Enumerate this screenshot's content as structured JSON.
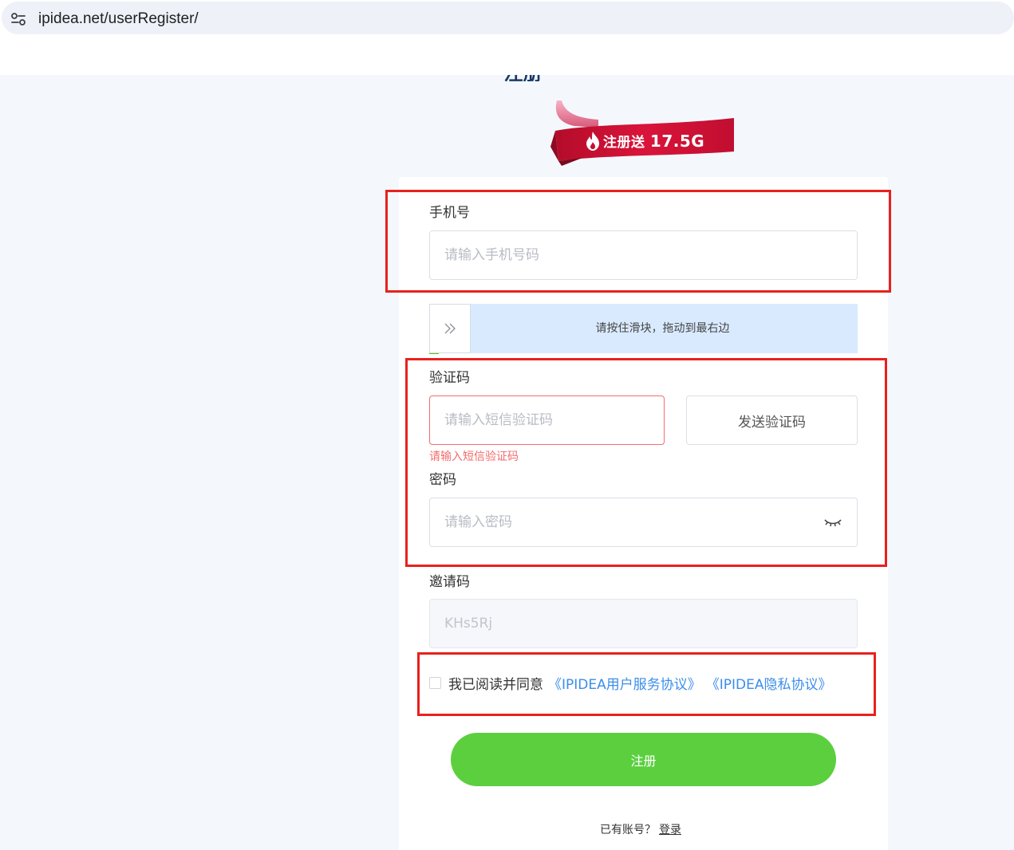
{
  "browser": {
    "url": "ipidea.net/userRegister/"
  },
  "page": {
    "title": "注册",
    "promo": {
      "text": "注册送",
      "amount": "17.5G"
    }
  },
  "form": {
    "phone": {
      "label": "手机号",
      "placeholder": "请输入手机号码",
      "value": ""
    },
    "slider": {
      "hint": "请按住滑块，拖动到最右边"
    },
    "code": {
      "label": "验证码",
      "placeholder": "请输入短信验证码",
      "value": "",
      "error": "请输入短信验证码",
      "send_button": "发送验证码"
    },
    "password": {
      "label": "密码",
      "placeholder": "请输入密码",
      "value": ""
    },
    "invite": {
      "label": "邀请码",
      "value": "KHs5Rj"
    },
    "agreement": {
      "text": "我已阅读并同意",
      "terms_link": "《IPIDEA用户服务协议》",
      "privacy_link": "《IPIDEA隐私协议》",
      "checked": false
    },
    "submit_label": "注册",
    "login_prompt": "已有账号？",
    "login_link": "登录"
  },
  "colors": {
    "accent_green": "#5ccf3f",
    "link_blue": "#3b8eea",
    "error_red": "#f56c6c",
    "annotation_red": "#e8211d",
    "ribbon_red": "#c8102e"
  }
}
